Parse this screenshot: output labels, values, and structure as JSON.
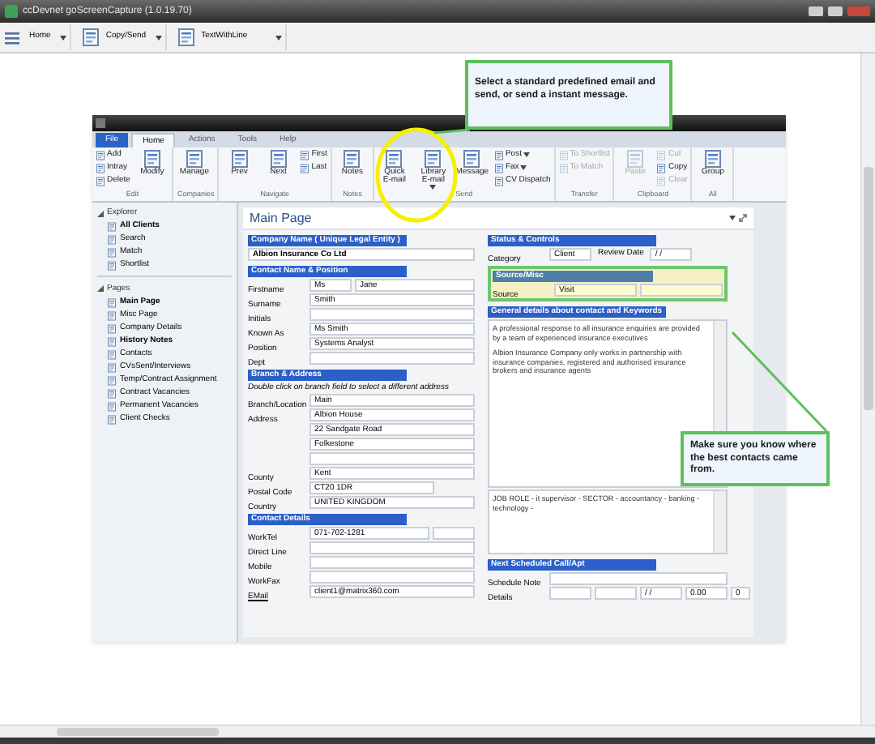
{
  "window": {
    "title": "ccDevnet goScreenCapture (1.0.19.70)"
  },
  "toolbar": [
    {
      "label": "Home"
    },
    {
      "label": "Copy/Send"
    },
    {
      "label": "TextWithLine"
    }
  ],
  "callouts": [
    {
      "text": "Select a standard predefined email and send, or send a instant message."
    },
    {
      "text": "Make sure you know where the best contacts came from."
    }
  ],
  "app": {
    "tabs": [
      {
        "label": "File",
        "kind": "file",
        "selected": false
      },
      {
        "label": "Home",
        "kind": "tab",
        "selected": true
      },
      {
        "label": "Actions",
        "kind": "tab",
        "selected": false
      },
      {
        "label": "Tools",
        "kind": "tab",
        "selected": false
      },
      {
        "label": "Help",
        "kind": "tab",
        "selected": false
      }
    ],
    "ribbon": [
      {
        "label": "Edit",
        "items": [
          {
            "label": "Add",
            "kind": "small",
            "disabled": false
          },
          {
            "label": "Intray",
            "kind": "small",
            "disabled": false
          },
          {
            "label": "Delete",
            "kind": "small",
            "disabled": false
          },
          {
            "label": "Modify",
            "kind": "large",
            "disabled": false
          }
        ]
      },
      {
        "label": "Companies",
        "items": [
          {
            "label": "Manage",
            "kind": "large",
            "disabled": false
          }
        ]
      },
      {
        "label": "Navigate",
        "items": [
          {
            "label": "Prev",
            "kind": "large",
            "disabled": false
          },
          {
            "label": "Next",
            "kind": "large",
            "disabled": false
          },
          {
            "label": "First",
            "kind": "small",
            "disabled": false
          },
          {
            "label": "Last",
            "kind": "small",
            "disabled": false
          }
        ]
      },
      {
        "label": "Notes",
        "items": [
          {
            "label": "Notes",
            "kind": "large",
            "disabled": false
          }
        ]
      },
      {
        "label": "Send",
        "items": [
          {
            "label": "Quick E-mail",
            "kind": "large",
            "disabled": false
          },
          {
            "label": "Library E-mail",
            "kind": "large",
            "dropdown": true,
            "disabled": false
          },
          {
            "label": "Message",
            "kind": "large",
            "disabled": false
          },
          {
            "label": "Post",
            "kind": "small",
            "dropdown": true,
            "disabled": false
          },
          {
            "label": "Fax",
            "kind": "small",
            "dropdown": true,
            "disabled": false
          },
          {
            "label": "CV Dispatch",
            "kind": "small",
            "disabled": false
          }
        ]
      },
      {
        "label": "Transfer",
        "items": [
          {
            "label": "To Shortlist",
            "kind": "small",
            "disabled": true
          },
          {
            "label": "To Match",
            "kind": "small",
            "disabled": true
          }
        ]
      },
      {
        "label": "Clipboard",
        "items": [
          {
            "label": "Paste",
            "kind": "large",
            "disabled": true
          },
          {
            "label": "Cut",
            "kind": "small",
            "disabled": true
          },
          {
            "label": "Copy",
            "kind": "small",
            "disabled": false
          },
          {
            "label": "Clear",
            "kind": "small",
            "disabled": true
          }
        ]
      },
      {
        "label": "All",
        "items": [
          {
            "label": "Group",
            "kind": "large",
            "disabled": false
          }
        ]
      }
    ],
    "sidebar": [
      {
        "title": "Explorer",
        "items": [
          {
            "label": "All Clients",
            "bold": true
          },
          {
            "label": "Search",
            "bold": false
          },
          {
            "label": "Match",
            "bold": false
          },
          {
            "label": "Shortlist",
            "bold": false
          }
        ]
      },
      {
        "title": "Pages",
        "items": [
          {
            "label": "Main Page",
            "bold": true
          },
          {
            "label": "Misc Page",
            "bold": false
          },
          {
            "label": "Company Details",
            "bold": false
          },
          {
            "label": "History Notes",
            "bold": true
          },
          {
            "label": "Contacts",
            "bold": false
          },
          {
            "label": "CVsSent/Interviews",
            "bold": false
          },
          {
            "label": "Temp/Contract Assignment",
            "bold": false
          },
          {
            "label": "Contract Vacancies",
            "bold": false
          },
          {
            "label": "Permanent Vacancies",
            "bold": false
          },
          {
            "label": "Client Checks",
            "bold": false
          }
        ]
      }
    ],
    "main": {
      "title": "Main Page",
      "left": [
        {
          "title": "Company Name ( Unique Legal Entity )",
          "highlighted": false,
          "rows": [
            {
              "fields": [
                {
                  "value": "Albion Insurance Co Ltd",
                  "kind": "bold"
                }
              ]
            }
          ]
        },
        {
          "title": "Contact Name & Position",
          "highlighted": false,
          "rows": [
            {
              "label": "Firstname",
              "fields": [
                {
                  "value": "Ms",
                  "kind": "short"
                },
                {
                  "value": "Jane"
                }
              ]
            },
            {
              "label": "Surname",
              "fields": [
                {
                  "value": "Smith"
                }
              ]
            },
            {
              "label": "Initials",
              "fields": [
                {
                  "kind": "full"
                }
              ]
            },
            {
              "label": "Known As",
              "fields": [
                {
                  "value": "Ms Smith"
                }
              ]
            },
            {
              "label": "Position",
              "fields": [
                {
                  "value": "Systems Analyst"
                }
              ]
            },
            {
              "label": "Dept",
              "fields": [
                {
                  "kind": "full"
                }
              ]
            }
          ]
        },
        {
          "title": "Branch & Address",
          "highlighted": false,
          "note": "Double click on branch field to select a different address",
          "rows": [
            {
              "label": "Branch/Location",
              "fields": [
                {
                  "value": "Main"
                }
              ]
            },
            {
              "label": "Address",
              "fields": [
                {
                  "value": "Albion House"
                }
              ]
            },
            {
              "fields": [
                {
                  "value": "22 Sandgate Road"
                }
              ]
            },
            {
              "fields": [
                {
                  "value": "Folkestone"
                }
              ]
            },
            {
              "fields": [
                {
                  "kind": "full"
                }
              ]
            },
            {
              "label": "County",
              "fields": [
                {
                  "value": "Kent"
                }
              ]
            },
            {
              "label": "Postal Code",
              "fields": [
                {
                  "value": "CT20 1DR",
                  "kind": "medium"
                }
              ]
            },
            {
              "label": "Country",
              "fields": [
                {
                  "value": "UNITED KINGDOM"
                }
              ]
            }
          ]
        },
        {
          "title": "Contact Details",
          "highlighted": false,
          "rows": [
            {
              "label": "WorkTel",
              "fields": [
                {
                  "value": "071-702-1281"
                },
                {
                  "kind": "short"
                }
              ]
            },
            {
              "label": "Direct Line",
              "fields": [
                {
                  "kind": "full"
                }
              ]
            },
            {
              "label": "Mobile",
              "fields": [
                {
                  "kind": "full"
                }
              ]
            },
            {
              "label": "WorkFax",
              "fields": [
                {
                  "kind": "full"
                }
              ]
            },
            {
              "label": "EMail",
              "link": true,
              "fields": [
                {
                  "value": "client1@matrix360.com"
                }
              ]
            }
          ]
        }
      ],
      "right": [
        {
          "title": "Status & Controls",
          "highlighted": false,
          "rows": [
            {
              "label": "Category",
              "fields": [
                {
                  "value": "Client",
                  "kind": "short"
                },
                {
                  "label": "Review Date",
                  "value": "/ /",
                  "kind": "short"
                }
              ]
            }
          ]
        },
        {
          "title": "Source/Misc",
          "highlighted": true,
          "rows": [
            {
              "label": "Source",
              "fields": [
                {
                  "value": "Visit"
                },
                {
                  "kind": "full"
                }
              ]
            }
          ]
        },
        {
          "title": "General details about contact and Keywords",
          "highlighted": false,
          "textareas": [
            {
              "paragraphs": [
                "A professional response to all insurance enquiries are provided by a team of experienced insurance executives",
                "Albion Insurance Company only works in partnership with insurance companies, registered and authorised insurance brokers and insurance agents"
              ],
              "kind": "tall"
            },
            {
              "paragraphs": [
                "JOB ROLE - it supervisor - SECTOR - accountancy - banking - technology -"
              ],
              "kind": "short"
            }
          ]
        },
        {
          "title": "Next Scheduled Call/Apt",
          "highlighted": false,
          "rows": [
            {
              "label": "Schedule Note",
              "fields": [
                {
                  "kind": "full"
                }
              ]
            },
            {
              "label": "Details",
              "fields": [
                {
                  "kind": "short"
                },
                {
                  "kind": "short"
                },
                {
                  "value": "/ /",
                  "kind": "short"
                },
                {
                  "value": "0.00",
                  "kind": "short"
                },
                {
                  "value": "0",
                  "kind": "tiny"
                }
              ]
            }
          ]
        }
      ]
    }
  }
}
